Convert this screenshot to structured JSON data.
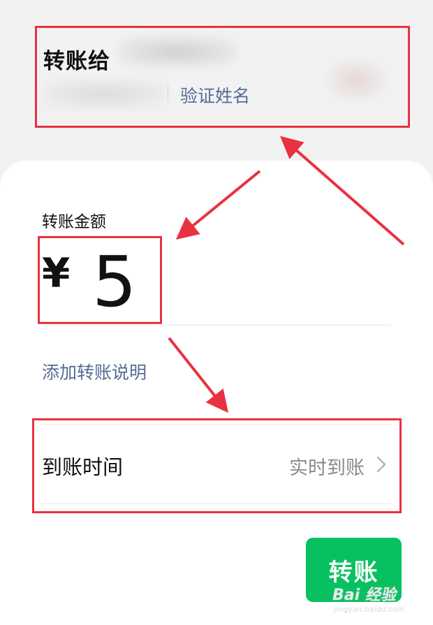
{
  "header": {
    "title": "转账给",
    "verify_link": "验证姓名"
  },
  "amount": {
    "label": "转账金额",
    "currency_symbol": "¥",
    "value": "5"
  },
  "note": {
    "add_label": "添加转账说明"
  },
  "arrival": {
    "label": "到账时间",
    "value": "实时到账"
  },
  "actions": {
    "transfer_label": "转账"
  },
  "watermark": {
    "main": "Bai 经验",
    "sub": "jingyan.baidu.com"
  },
  "colors": {
    "accent_green": "#07c160",
    "link_blue": "#576b95",
    "annotation_red": "#e8323f"
  }
}
